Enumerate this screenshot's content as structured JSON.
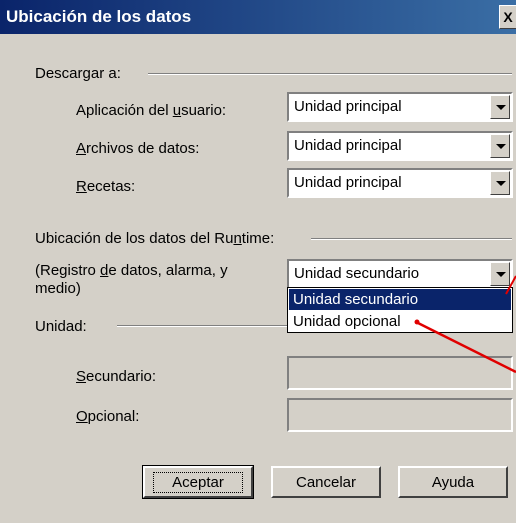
{
  "window": {
    "title": "Ubicación de los datos",
    "close_label": "X"
  },
  "download": {
    "section_label": "Descargar a:",
    "rows": [
      {
        "label_pre": "Aplicación del ",
        "label_u": "u",
        "label_post": "suario:",
        "value": "Unidad principal"
      },
      {
        "label_pre": "",
        "label_u": "A",
        "label_post": "rchivos de datos:",
        "value": "Unidad principal"
      },
      {
        "label_pre": "",
        "label_u": "R",
        "label_post": "ecetas:",
        "value": "Unidad principal"
      }
    ]
  },
  "runtime": {
    "section_label_pre": "Ubicación de los datos del Ru",
    "section_label_u": "n",
    "section_label_post": "time:",
    "desc_pre": "(Registro ",
    "desc_u": "d",
    "desc_post": "e datos, alarma, y",
    "desc_line2": "medio)",
    "value": "Unidad secundario",
    "options": [
      "Unidad secundario",
      "Unidad opcional"
    ],
    "selected_index": 0
  },
  "unit": {
    "section_label": "Unidad:",
    "secondary_u": "S",
    "secondary_post": "ecundario:",
    "optional_u": "O",
    "optional_post": "pcional:"
  },
  "buttons": {
    "ok": "Aceptar",
    "cancel": "Cancelar",
    "help": "Ayuda"
  },
  "annotation_color": "#e00000"
}
